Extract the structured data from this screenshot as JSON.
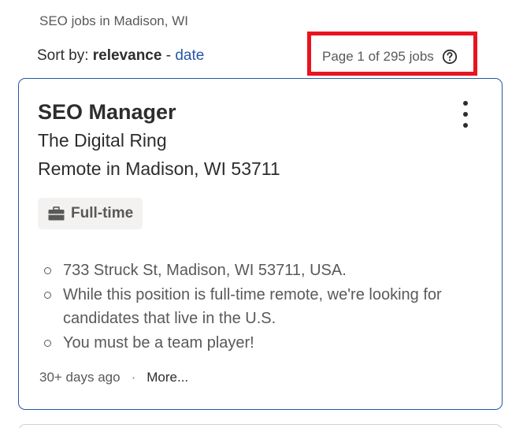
{
  "breadcrumb": "SEO jobs in Madison, WI",
  "sort": {
    "prefix": "Sort by: ",
    "current": "relevance",
    "separator": " - ",
    "alternative": "date"
  },
  "pagination": {
    "text": "Page 1 of 295 jobs",
    "help_icon": "question-circle-icon"
  },
  "highlight_color": "#e8141f",
  "accent_color": "#2557a7",
  "job": {
    "title": "SEO Manager",
    "company": "The Digital Ring",
    "location": "Remote in Madison, WI 53711",
    "job_type": "Full-time",
    "job_type_icon": "briefcase-icon",
    "menu_icon": "more-vertical-icon",
    "snippet": [
      "733 Struck St, Madison, WI 53711, USA.",
      "While this position is full-time remote, we're looking for candidates that live in the U.S.",
      "You must be a team player!"
    ],
    "posted": "30+ days ago",
    "separator": "·",
    "more_label": "More..."
  }
}
